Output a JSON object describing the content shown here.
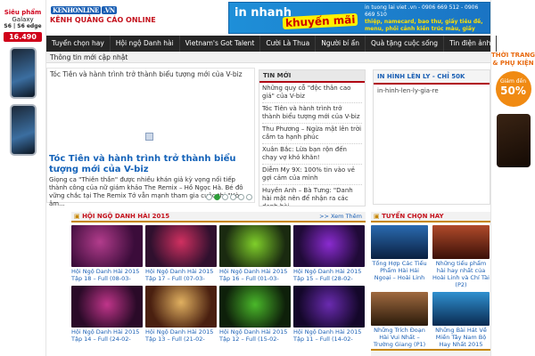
{
  "left_ad": {
    "line1": "Siêu phẩm",
    "line2": "Galaxy",
    "line3": "S6 | S6 edge",
    "price": "16.490"
  },
  "right_ad": {
    "title": "THỜI TRANG & PHỤ KIỆN",
    "sale_label": "Giảm đến",
    "sale_value": "50%"
  },
  "header": {
    "logo_brand": "KENHONLINE",
    "logo_tld": ".VN",
    "logo_tagline": "KÊNH QUẢNG CÁO ONLINE",
    "banner_main": "in nhanh",
    "banner_promo": "khuyến mãi",
    "banner_contact": "in tuong lai viet .vn - 0906 669 512 - 0906 669 510",
    "banner_services": "thiệp, namecard, bao thư, giấy tiêu đề, menu, phối cảnh kiến trúc màu, giấy chứng nhận, profile công ty, v.v..."
  },
  "nav": {
    "items": [
      "Tuyển chọn hay",
      "Hội ngộ Danh hài",
      "Vietnam's Got Talent",
      "Cười Là Thua",
      "Người bí ẩn",
      "Quà tặng cuộc sống",
      "Tin điện ảnh"
    ]
  },
  "subnav": {
    "label": "Thông tin mới cập nhật"
  },
  "slider": {
    "top_title": "Tóc Tiên và hành trình trở thành biểu tượng mới của V-biz",
    "headline": "Tóc Tiên và hành trình trở thành biểu tượng mới của V-biz",
    "description": "Giọng ca \"Thiên thần\" được nhiều khán giả kỳ vọng nối tiếp thành công của nữ giám khảo The Remix – Hồ Ngọc Hà. Bé đô vững chắc tại The Remix Tớ vẫn mạnh tham gia cuộc thi \"Hòa âm..."
  },
  "news": {
    "title": "TIN MỚI",
    "items": [
      "Những quy cỗ \"độc thân cao giá\" của V-biz",
      "Tóc Tiên và hành trình trở thành biểu tượng mới của V-biz",
      "Thu Phương – Ngừa mật lên trời cầm ta hạnh phúc",
      "Xuân Bắc: Lừa bạn rộn đến chạy vợ khó khăn!",
      "Diễm My 9X: 100% tin vào vẻ gợi cảm của mình",
      "Huyền Anh – Bà Tưng: \"Danh hài mật nên để nhận ra các danh hài"
    ]
  },
  "right_box": {
    "title": "IN HÌNH LÊN LY - CHỈ 50K",
    "text": "in-hinh-len-ly-gia-re"
  },
  "section_main": {
    "title": "HỘI NGỘ DANH HÀI 2015",
    "more": ">> Xem Thêm",
    "videos": [
      "Hội Ngộ Danh Hài 2015 Tập 18 – Full (08-03-2015)",
      "Hội Ngộ Danh Hài 2015 Tập 17 – Full (07-03-2015)",
      "Hội Ngộ Danh Hài 2015 Tập 16 – Full (01-03-2015)",
      "Hội Ngộ Danh Hài 2015 Tập 15 – Full (28-02-2015)",
      "Hội Ngộ Danh Hài 2015 Tập 14 – Full (24-02-2015)",
      "Hội Ngộ Danh Hài 2015 Tập 13 – Full (21-02-2015)",
      "Hội Ngộ Danh Hài 2015 Tập 12 – Full (15-02-2015)",
      "Hội Ngộ Danh Hài 2015 Tập 11 – Full (14-02-2015)"
    ]
  },
  "section_side": {
    "title": "TUYỂN CHỌN HAY",
    "videos": [
      "Tổng Hợp Các Tiểu Phẩm Hài Hải Ngoại – Hoài Linh",
      "Những tiểu phẩm hài hay nhất của Hoài Linh và Chí Tài (P2)",
      "Những Trích Đoạn Hài Vui Nhất – Trường Giang (P1)",
      "Những Bài Hát Về Miền Tây Nam Bộ Hay Nhất 2015"
    ]
  }
}
